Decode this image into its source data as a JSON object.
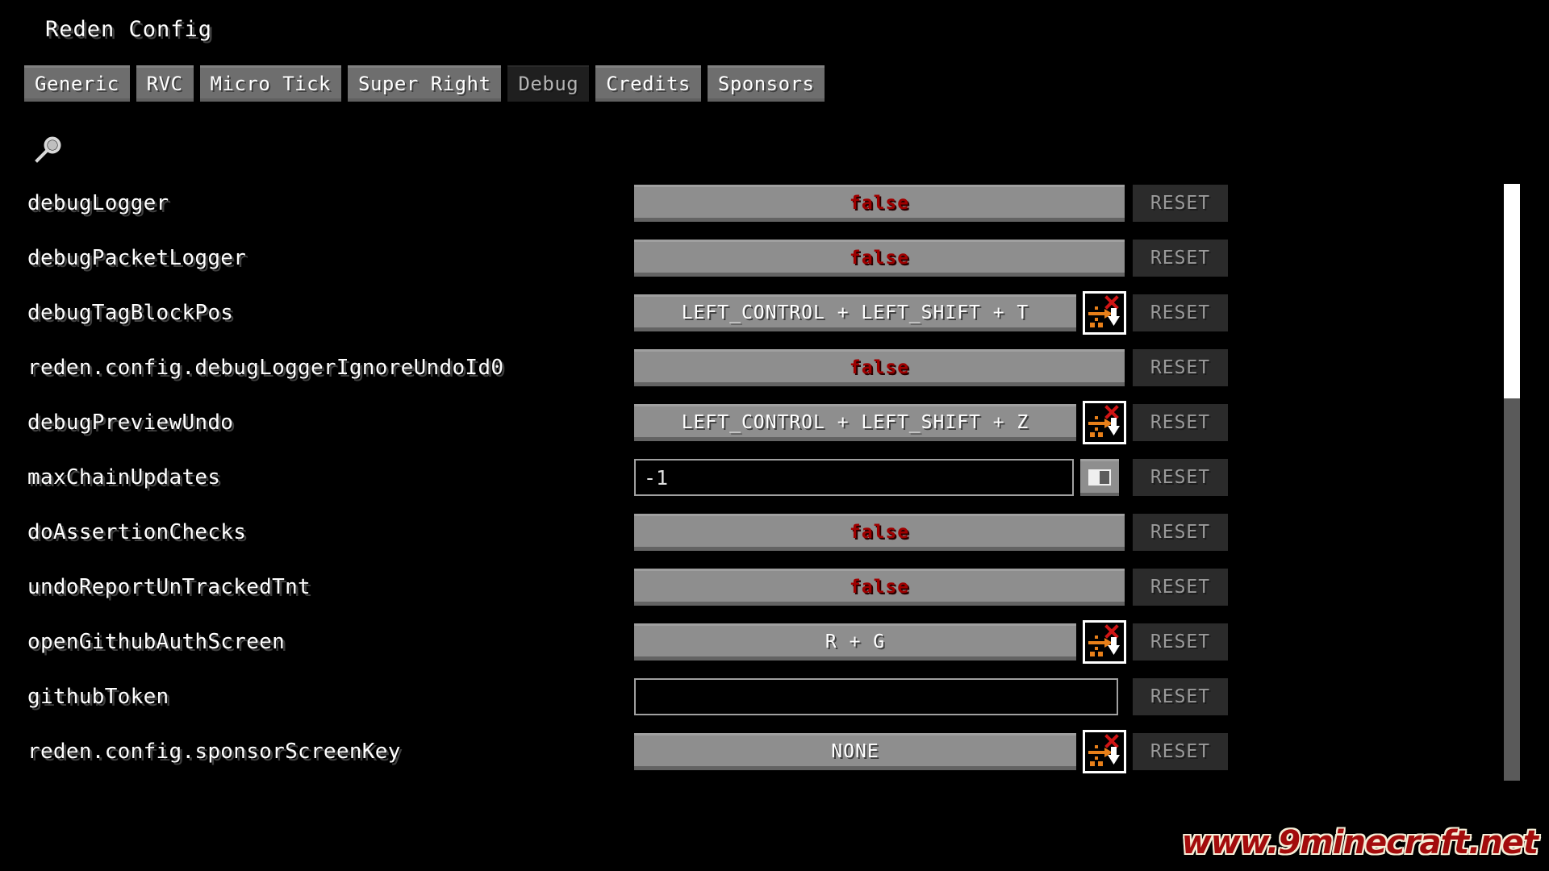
{
  "window": {
    "title": "Reden Config"
  },
  "tabs": [
    {
      "label": "Generic",
      "selected": false
    },
    {
      "label": "RVC",
      "selected": false
    },
    {
      "label": "Micro Tick",
      "selected": false
    },
    {
      "label": "Super Right",
      "selected": false
    },
    {
      "label": "Debug",
      "selected": true
    },
    {
      "label": "Credits",
      "selected": false
    },
    {
      "label": "Sponsors",
      "selected": false
    }
  ],
  "search": {
    "icon": "search-icon",
    "value": "",
    "placeholder": ""
  },
  "reset_label": "RESET",
  "rows": [
    {
      "label": "debugLogger",
      "control": "toggle",
      "value": "false",
      "extra_icon": "none",
      "reset_enabled": false
    },
    {
      "label": "debugPacketLogger",
      "control": "toggle",
      "value": "false",
      "extra_icon": "none",
      "reset_enabled": false
    },
    {
      "label": "debugTagBlockPos",
      "control": "keybind",
      "value": "LEFT_CONTROL + LEFT_SHIFT + T",
      "extra_icon": "keybind-conflict-icon",
      "reset_enabled": false
    },
    {
      "label": "reden.config.debugLoggerIgnoreUndoId0",
      "control": "toggle",
      "value": "false",
      "extra_icon": "none",
      "reset_enabled": false
    },
    {
      "label": "debugPreviewUndo",
      "control": "keybind",
      "value": "LEFT_CONTROL + LEFT_SHIFT + Z",
      "extra_icon": "keybind-conflict-icon",
      "reset_enabled": false
    },
    {
      "label": "maxChainUpdates",
      "control": "textfield",
      "value": "-1",
      "extra_icon": "slider-toggle-icon",
      "reset_enabled": false
    },
    {
      "label": "doAssertionChecks",
      "control": "toggle",
      "value": "false",
      "extra_icon": "none",
      "reset_enabled": false
    },
    {
      "label": "undoReportUnTrackedTnt",
      "control": "toggle",
      "value": "false",
      "extra_icon": "none",
      "reset_enabled": false
    },
    {
      "label": "openGithubAuthScreen",
      "control": "keybind",
      "value": "R + G",
      "extra_icon": "keybind-conflict-icon",
      "reset_enabled": false
    },
    {
      "label": "githubToken",
      "control": "textfield",
      "value": "",
      "extra_icon": "none",
      "reset_enabled": false
    },
    {
      "label": "reden.config.sponsorScreenKey",
      "control": "keybind",
      "value": "NONE",
      "extra_icon": "keybind-conflict-icon",
      "reset_enabled": false
    }
  ],
  "scrollbar": {
    "thumb_position_percent": 0,
    "thumb_size_percent": 36
  },
  "watermark": {
    "text": "www.9minecraft.net"
  },
  "colors": {
    "background": "#000000",
    "button_face": "#8e8e8e",
    "tab_selected": "#1f1f1f",
    "value_false": "#a00000",
    "reset_disabled_bg": "#2b2b2b",
    "scrollbar_thumb": "#ffffff",
    "scrollbar_track": "#5a5a5a",
    "watermark": "#a30c0c",
    "keybind_icon_orange": "#e8801a",
    "keybind_icon_red": "#d01414"
  }
}
